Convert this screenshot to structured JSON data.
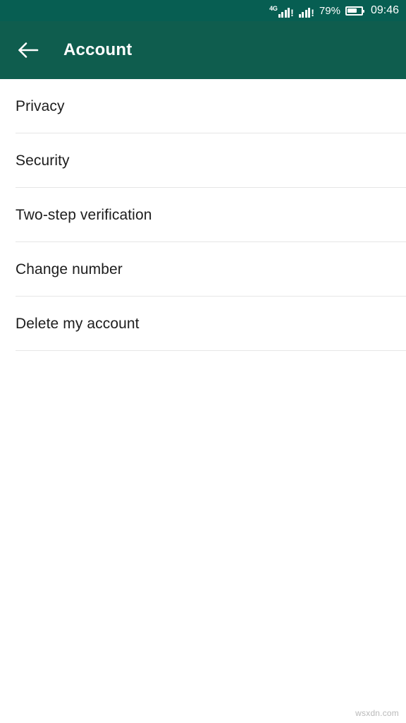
{
  "status_bar": {
    "network_label": "4G",
    "sim1_exclamation": "!",
    "sim2_exclamation": "!",
    "battery_percent": "79%",
    "battery_level": 70,
    "time": "09:46",
    "background_color": "#075e52"
  },
  "app_bar": {
    "back_icon": "arrow-left-icon",
    "title": "Account",
    "background_color": "#0f5d4e",
    "text_color": "#ffffff"
  },
  "list": {
    "items": [
      {
        "label": "Privacy"
      },
      {
        "label": "Security"
      },
      {
        "label": "Two-step verification"
      },
      {
        "label": "Change number"
      },
      {
        "label": "Delete my account"
      }
    ],
    "divider_color": "#e6e6e6",
    "text_color": "#1d1d1d"
  },
  "watermark": {
    "text": "wsxdn.com"
  }
}
